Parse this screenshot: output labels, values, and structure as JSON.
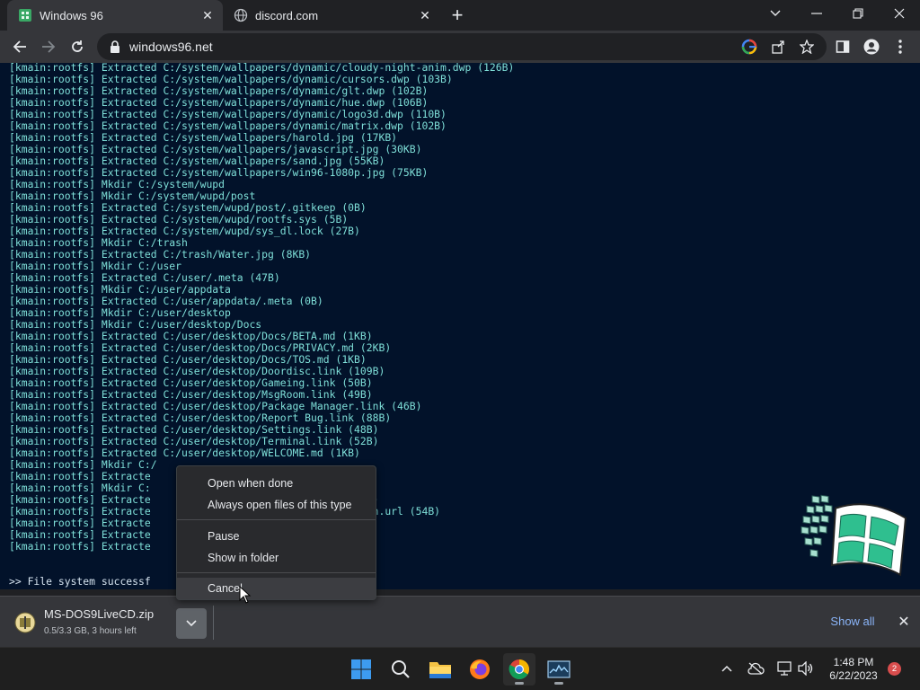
{
  "browser": {
    "tabs": [
      {
        "title": "Windows 96",
        "active": true
      },
      {
        "title": "discord.com",
        "active": false
      }
    ],
    "url": "windows96.net"
  },
  "terminal": {
    "lines": [
      "[kmain:rootfs] Extracted C:/system/wallpapers/dynamic/cloudy-night-anim.dwp (126B)",
      "[kmain:rootfs] Extracted C:/system/wallpapers/dynamic/cursors.dwp (103B)",
      "[kmain:rootfs] Extracted C:/system/wallpapers/dynamic/glt.dwp (102B)",
      "[kmain:rootfs] Extracted C:/system/wallpapers/dynamic/hue.dwp (106B)",
      "[kmain:rootfs] Extracted C:/system/wallpapers/dynamic/logo3d.dwp (110B)",
      "[kmain:rootfs] Extracted C:/system/wallpapers/dynamic/matrix.dwp (102B)",
      "[kmain:rootfs] Extracted C:/system/wallpapers/harold.jpg (17KB)",
      "[kmain:rootfs] Extracted C:/system/wallpapers/javascript.jpg (30KB)",
      "[kmain:rootfs] Extracted C:/system/wallpapers/sand.jpg (55KB)",
      "[kmain:rootfs] Extracted C:/system/wallpapers/win96-1080p.jpg (75KB)",
      "[kmain:rootfs] Mkdir C:/system/wupd",
      "[kmain:rootfs] Mkdir C:/system/wupd/post",
      "[kmain:rootfs] Extracted C:/system/wupd/post/.gitkeep (0B)",
      "[kmain:rootfs] Extracted C:/system/wupd/rootfs.sys (5B)",
      "[kmain:rootfs] Extracted C:/system/wupd/sys_dl.lock (27B)",
      "[kmain:rootfs] Mkdir C:/trash",
      "[kmain:rootfs] Extracted C:/trash/Water.jpg (8KB)",
      "[kmain:rootfs] Mkdir C:/user",
      "[kmain:rootfs] Extracted C:/user/.meta (47B)",
      "[kmain:rootfs] Mkdir C:/user/appdata",
      "[kmain:rootfs] Extracted C:/user/appdata/.meta (0B)",
      "[kmain:rootfs] Mkdir C:/user/desktop",
      "[kmain:rootfs] Mkdir C:/user/desktop/Docs",
      "[kmain:rootfs] Extracted C:/user/desktop/Docs/BETA.md (1KB)",
      "[kmain:rootfs] Extracted C:/user/desktop/Docs/PRIVACY.md (2KB)",
      "[kmain:rootfs] Extracted C:/user/desktop/Docs/TOS.md (1KB)",
      "[kmain:rootfs] Extracted C:/user/desktop/Doordisc.link (109B)",
      "[kmain:rootfs] Extracted C:/user/desktop/Gameing.link (50B)",
      "[kmain:rootfs] Extracted C:/user/desktop/MsgRoom.link (49B)",
      "[kmain:rootfs] Extracted C:/user/desktop/Package Manager.link (46B)",
      "[kmain:rootfs] Extracted C:/user/desktop/Report Bug.link (88B)",
      "[kmain:rootfs] Extracted C:/user/desktop/Settings.link (48B)",
      "[kmain:rootfs] Extracted C:/user/desktop/Terminal.link (52B)",
      "[kmain:rootfs] Extracted C:/user/desktop/WELCOME.md (1KB)",
      "[kmain:rootfs] Mkdir C:/",
      "[kmain:rootfs] Extracte                          (64KB)",
      "[kmain:rootfs] Mkdir C:",
      "[kmain:rootfs] Extracte                          e.url (54B)",
      "[kmain:rootfs] Extracte                          cumentation.url (54B)",
      "[kmain:rootfs] Extracte                          53B)",
      "[kmain:rootfs] Extracte                          1B)",
      "[kmain:rootfs] Extracte                          B)"
    ],
    "final_line": ">> File system successf",
    "progress_fraction": 0.9
  },
  "download": {
    "filename": "MS-DOS9LiveCD.zip",
    "status": "0.5/3.3 GB, 3 hours left",
    "show_all": "Show all"
  },
  "context_menu": {
    "open_when_done": "Open when done",
    "always_open": "Always open files of this type",
    "pause": "Pause",
    "show_in_folder": "Show in folder",
    "cancel": "Cancel"
  },
  "taskbar": {
    "time": "1:48 PM",
    "date": "6/22/2023",
    "notification_count": "2"
  },
  "colors": {
    "terminal_bg": "#02122a",
    "terminal_text": "#7fe0d9",
    "link_accent": "#8ab4f8"
  }
}
